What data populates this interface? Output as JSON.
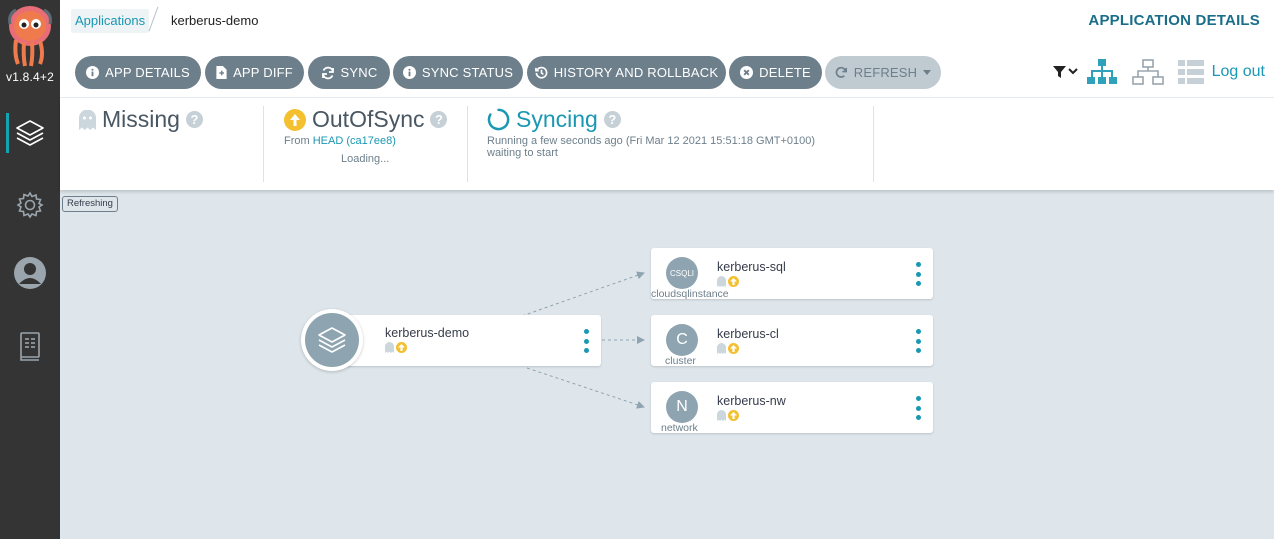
{
  "sidebar": {
    "version": "v1.8.4+2",
    "items": [
      {
        "name": "applications",
        "active": true
      },
      {
        "name": "settings",
        "active": false
      },
      {
        "name": "user-info",
        "active": false
      },
      {
        "name": "docs",
        "active": false
      }
    ]
  },
  "header": {
    "breadcrumb_link": "Applications",
    "breadcrumb_current": "kerberus-demo",
    "page_title": "APPLICATION DETAILS"
  },
  "toolbar": {
    "buttons": [
      {
        "label": "APP DETAILS",
        "icon": "info-circle-icon"
      },
      {
        "label": "APP DIFF",
        "icon": "file-diff-icon"
      },
      {
        "label": "SYNC",
        "icon": "sync-icon"
      },
      {
        "label": "SYNC STATUS",
        "icon": "info-circle-icon"
      },
      {
        "label": "HISTORY AND ROLLBACK",
        "icon": "history-icon"
      },
      {
        "label": "DELETE",
        "icon": "times-circle-icon"
      },
      {
        "label": "REFRESH",
        "icon": "redo-icon",
        "disabled": true
      }
    ],
    "logout": "Log out"
  },
  "status": {
    "health": {
      "label": "Missing",
      "icon": "ghost-icon"
    },
    "sync": {
      "label": "OutOfSync",
      "from_prefix": "From ",
      "revision": "HEAD (ca17ee8)",
      "loading": "Loading...",
      "icon": "arrow-circle-up-icon",
      "color": "#f4c030"
    },
    "operation": {
      "label": "Syncing",
      "time": "Running a few seconds ago (Fri Mar 12 2021 15:51:18 GMT+0100)",
      "message": "waiting to start",
      "icon": "spinner-icon",
      "color": "#1a97b3"
    }
  },
  "refresh_tag": "Refreshing",
  "graph": {
    "app": {
      "name": "kerberus-demo",
      "icon": "layers-icon"
    },
    "resources": [
      {
        "name": "kerberus-sql",
        "kind_abbr": "CSQLI",
        "kind": "cloudsqlinstance"
      },
      {
        "name": "kerberus-cl",
        "kind_abbr": "C",
        "kind": "cluster"
      },
      {
        "name": "kerberus-nw",
        "kind_abbr": "N",
        "kind": "network"
      }
    ]
  },
  "colors": {
    "accent": "#1a97b3",
    "button": "#6d7f8b",
    "sidebar": "#343434",
    "out_of_sync": "#f4c030",
    "background": "#dee6eb"
  }
}
